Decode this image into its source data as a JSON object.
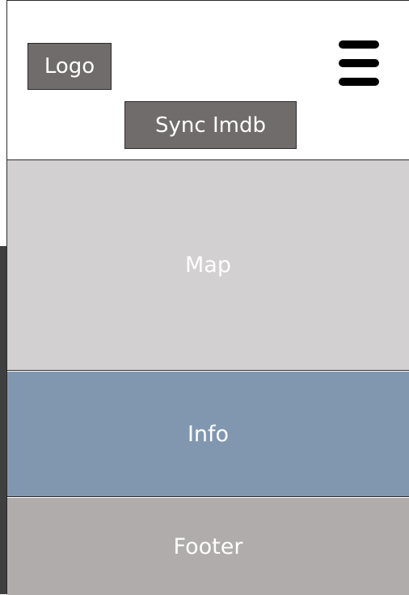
{
  "header": {
    "logo_label": "Logo",
    "sync_button_label": "Sync Imdb",
    "menu_icon": "hamburger-icon"
  },
  "sections": {
    "map_label": "Map",
    "info_label": "Info",
    "footer_label": "Footer"
  },
  "colors": {
    "logo_bg": "#716c6c",
    "button_bg": "#716c6c",
    "map_bg": "#d2d0d1",
    "info_bg": "#8197b0",
    "footer_bg": "#b0acab"
  }
}
